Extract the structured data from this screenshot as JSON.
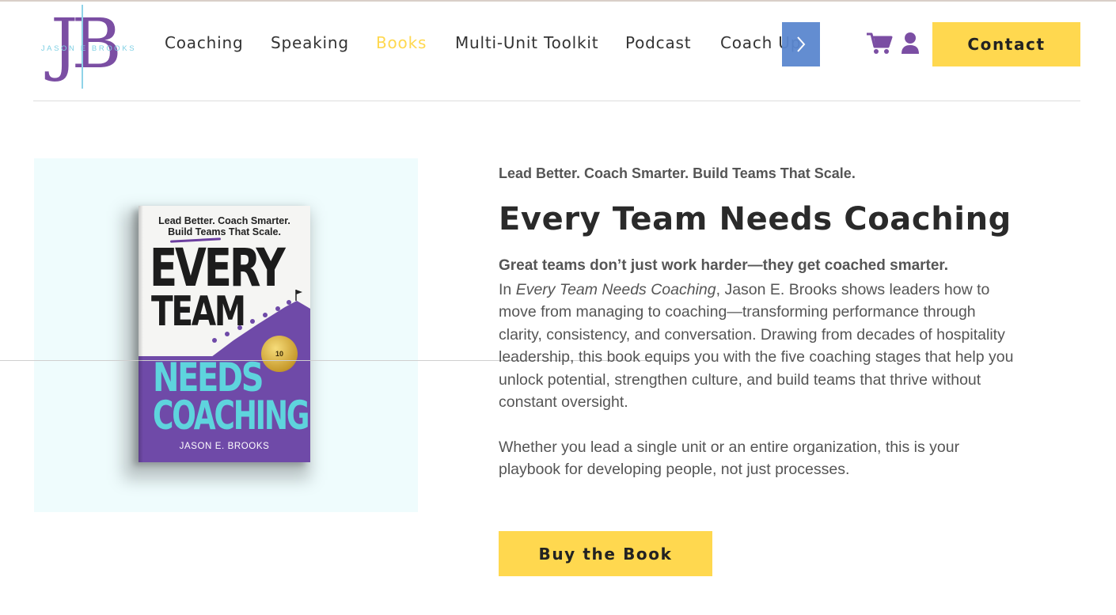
{
  "brand": {
    "logo_letters": "JB",
    "logo_text": "JASON E BROOKS"
  },
  "nav": {
    "items": [
      {
        "label": "Coaching",
        "active": false
      },
      {
        "label": "Speaking",
        "active": false
      },
      {
        "label": "Books",
        "active": true
      },
      {
        "label": "Multi-Unit Toolkit",
        "active": false
      },
      {
        "label": "Podcast",
        "active": false
      },
      {
        "label": "Coach Up",
        "active": false
      }
    ],
    "contact_label": "Contact"
  },
  "book_cover": {
    "tagline_line1": "Lead Better. Coach Smarter.",
    "tagline_line2": "Build Teams That Scale.",
    "word1": "EVERY",
    "word2": "TEAM",
    "word3": "NEEDS",
    "word4": "COACHING",
    "seal_text": "10",
    "author": "JASON E. BROOKS"
  },
  "content": {
    "eyebrow": "Lead Better. Coach Smarter. Build Teams That Scale.",
    "title": "Every Team Needs Coaching",
    "lead": "Great teams don’t just work harder—they get coached smarter.",
    "body_prefix": "In ",
    "body_book_title": "Every Team Needs Coaching",
    "body_rest": ", Jason E. Brooks shows leaders how to move from managing to coaching—transforming performance through clarity, consistency, and conversation. Drawing from decades of hospitality leadership, this book equips you with the five coaching stages that help you unlock potential, strengthen culture, and build teams that thrive without constant oversight.",
    "body2": "Whether you lead a single unit or an entire organization, this is your playbook for developing people, not just processes.",
    "buy_label": "Buy the Book"
  },
  "colors": {
    "accent_yellow": "#ffd84f",
    "brand_purple": "#7b4ea3",
    "brand_teal": "#7fd0e4",
    "panel_bg": "#effcfd"
  },
  "icons": [
    "chevron-right-icon",
    "cart-icon",
    "user-icon"
  ]
}
